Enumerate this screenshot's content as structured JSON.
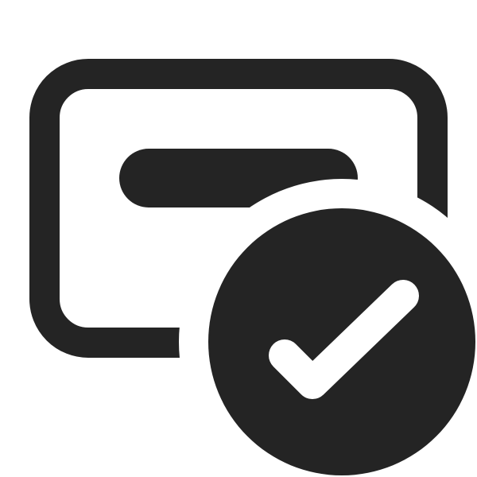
{
  "icon": {
    "name": "text-box-checkmark-icon",
    "parts": [
      "rounded-rectangle-outline",
      "text-line-bar",
      "checkmark-badge"
    ],
    "colors": {
      "foreground": "#242424",
      "background": "#ffffff"
    }
  }
}
